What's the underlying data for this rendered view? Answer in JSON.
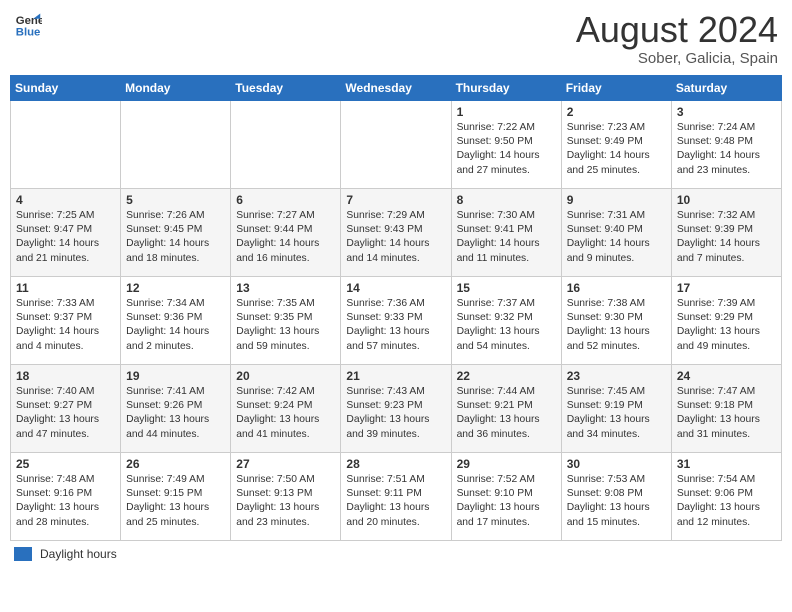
{
  "header": {
    "logo_line1": "General",
    "logo_line2": "Blue",
    "main_title": "August 2024",
    "subtitle": "Sober, Galicia, Spain"
  },
  "legend": {
    "label": "Daylight hours"
  },
  "days_of_week": [
    "Sunday",
    "Monday",
    "Tuesday",
    "Wednesday",
    "Thursday",
    "Friday",
    "Saturday"
  ],
  "weeks": [
    {
      "days": [
        {
          "number": "",
          "info": ""
        },
        {
          "number": "",
          "info": ""
        },
        {
          "number": "",
          "info": ""
        },
        {
          "number": "",
          "info": ""
        },
        {
          "number": "1",
          "info": "Sunrise: 7:22 AM\nSunset: 9:50 PM\nDaylight: 14 hours and 27 minutes."
        },
        {
          "number": "2",
          "info": "Sunrise: 7:23 AM\nSunset: 9:49 PM\nDaylight: 14 hours and 25 minutes."
        },
        {
          "number": "3",
          "info": "Sunrise: 7:24 AM\nSunset: 9:48 PM\nDaylight: 14 hours and 23 minutes."
        }
      ]
    },
    {
      "days": [
        {
          "number": "4",
          "info": "Sunrise: 7:25 AM\nSunset: 9:47 PM\nDaylight: 14 hours and 21 minutes."
        },
        {
          "number": "5",
          "info": "Sunrise: 7:26 AM\nSunset: 9:45 PM\nDaylight: 14 hours and 18 minutes."
        },
        {
          "number": "6",
          "info": "Sunrise: 7:27 AM\nSunset: 9:44 PM\nDaylight: 14 hours and 16 minutes."
        },
        {
          "number": "7",
          "info": "Sunrise: 7:29 AM\nSunset: 9:43 PM\nDaylight: 14 hours and 14 minutes."
        },
        {
          "number": "8",
          "info": "Sunrise: 7:30 AM\nSunset: 9:41 PM\nDaylight: 14 hours and 11 minutes."
        },
        {
          "number": "9",
          "info": "Sunrise: 7:31 AM\nSunset: 9:40 PM\nDaylight: 14 hours and 9 minutes."
        },
        {
          "number": "10",
          "info": "Sunrise: 7:32 AM\nSunset: 9:39 PM\nDaylight: 14 hours and 7 minutes."
        }
      ]
    },
    {
      "days": [
        {
          "number": "11",
          "info": "Sunrise: 7:33 AM\nSunset: 9:37 PM\nDaylight: 14 hours and 4 minutes."
        },
        {
          "number": "12",
          "info": "Sunrise: 7:34 AM\nSunset: 9:36 PM\nDaylight: 14 hours and 2 minutes."
        },
        {
          "number": "13",
          "info": "Sunrise: 7:35 AM\nSunset: 9:35 PM\nDaylight: 13 hours and 59 minutes."
        },
        {
          "number": "14",
          "info": "Sunrise: 7:36 AM\nSunset: 9:33 PM\nDaylight: 13 hours and 57 minutes."
        },
        {
          "number": "15",
          "info": "Sunrise: 7:37 AM\nSunset: 9:32 PM\nDaylight: 13 hours and 54 minutes."
        },
        {
          "number": "16",
          "info": "Sunrise: 7:38 AM\nSunset: 9:30 PM\nDaylight: 13 hours and 52 minutes."
        },
        {
          "number": "17",
          "info": "Sunrise: 7:39 AM\nSunset: 9:29 PM\nDaylight: 13 hours and 49 minutes."
        }
      ]
    },
    {
      "days": [
        {
          "number": "18",
          "info": "Sunrise: 7:40 AM\nSunset: 9:27 PM\nDaylight: 13 hours and 47 minutes."
        },
        {
          "number": "19",
          "info": "Sunrise: 7:41 AM\nSunset: 9:26 PM\nDaylight: 13 hours and 44 minutes."
        },
        {
          "number": "20",
          "info": "Sunrise: 7:42 AM\nSunset: 9:24 PM\nDaylight: 13 hours and 41 minutes."
        },
        {
          "number": "21",
          "info": "Sunrise: 7:43 AM\nSunset: 9:23 PM\nDaylight: 13 hours and 39 minutes."
        },
        {
          "number": "22",
          "info": "Sunrise: 7:44 AM\nSunset: 9:21 PM\nDaylight: 13 hours and 36 minutes."
        },
        {
          "number": "23",
          "info": "Sunrise: 7:45 AM\nSunset: 9:19 PM\nDaylight: 13 hours and 34 minutes."
        },
        {
          "number": "24",
          "info": "Sunrise: 7:47 AM\nSunset: 9:18 PM\nDaylight: 13 hours and 31 minutes."
        }
      ]
    },
    {
      "days": [
        {
          "number": "25",
          "info": "Sunrise: 7:48 AM\nSunset: 9:16 PM\nDaylight: 13 hours and 28 minutes."
        },
        {
          "number": "26",
          "info": "Sunrise: 7:49 AM\nSunset: 9:15 PM\nDaylight: 13 hours and 25 minutes."
        },
        {
          "number": "27",
          "info": "Sunrise: 7:50 AM\nSunset: 9:13 PM\nDaylight: 13 hours and 23 minutes."
        },
        {
          "number": "28",
          "info": "Sunrise: 7:51 AM\nSunset: 9:11 PM\nDaylight: 13 hours and 20 minutes."
        },
        {
          "number": "29",
          "info": "Sunrise: 7:52 AM\nSunset: 9:10 PM\nDaylight: 13 hours and 17 minutes."
        },
        {
          "number": "30",
          "info": "Sunrise: 7:53 AM\nSunset: 9:08 PM\nDaylight: 13 hours and 15 minutes."
        },
        {
          "number": "31",
          "info": "Sunrise: 7:54 AM\nSunset: 9:06 PM\nDaylight: 13 hours and 12 minutes."
        }
      ]
    }
  ]
}
